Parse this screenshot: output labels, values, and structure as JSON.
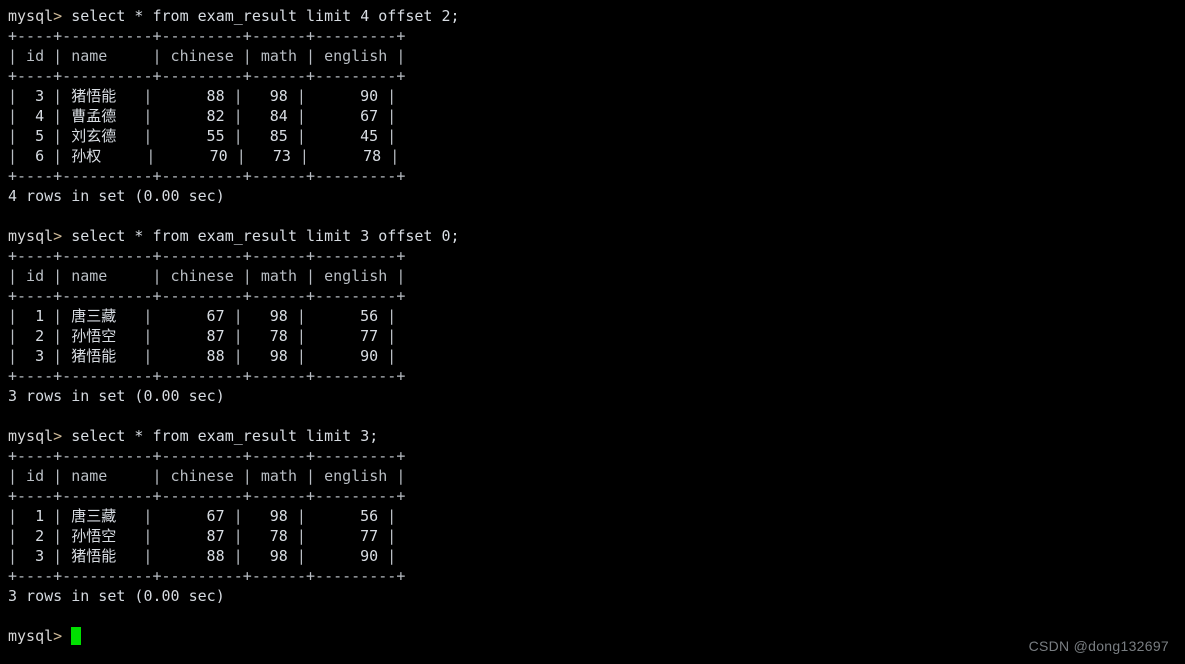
{
  "terminal": {
    "background_color": "#000000",
    "foreground_color": "#cdd2d8",
    "cursor_color": "#00e000",
    "prompt": "mysql>",
    "blocks": [
      {
        "command": " select * from exam_result limit 4 offset 2;",
        "separator": "+----+----------+---------+------+---------+",
        "header": "| id | name     | chinese | math | english |",
        "rows": [
          {
            "id": "3",
            "name": "猪悟能",
            "chinese": "88",
            "math": "98",
            "english": "90"
          },
          {
            "id": "4",
            "name": "曹孟德",
            "chinese": "82",
            "math": "84",
            "english": "67"
          },
          {
            "id": "5",
            "name": "刘玄德",
            "chinese": "55",
            "math": "85",
            "english": "45"
          },
          {
            "id": "6",
            "name": "孙权",
            "chinese": "70",
            "math": "73",
            "english": "78"
          }
        ],
        "status": "4 rows in set (0.00 sec)"
      },
      {
        "command": " select * from exam_result limit 3 offset 0;",
        "separator": "+----+----------+---------+------+---------+",
        "header": "| id | name     | chinese | math | english |",
        "rows": [
          {
            "id": "1",
            "name": "唐三藏",
            "chinese": "67",
            "math": "98",
            "english": "56"
          },
          {
            "id": "2",
            "name": "孙悟空",
            "chinese": "87",
            "math": "78",
            "english": "77"
          },
          {
            "id": "3",
            "name": "猪悟能",
            "chinese": "88",
            "math": "98",
            "english": "90"
          }
        ],
        "status": "3 rows in set (0.00 sec)"
      },
      {
        "command": " select * from exam_result limit 3;",
        "separator": "+----+----------+---------+------+---------+",
        "header": "| id | name     | chinese | math | english |",
        "rows": [
          {
            "id": "1",
            "name": "唐三藏",
            "chinese": "67",
            "math": "98",
            "english": "56"
          },
          {
            "id": "2",
            "name": "孙悟空",
            "chinese": "87",
            "math": "78",
            "english": "77"
          },
          {
            "id": "3",
            "name": "猪悟能",
            "chinese": "88",
            "math": "98",
            "english": "90"
          }
        ],
        "status": "3 rows in set (0.00 sec)"
      }
    ],
    "final_prompt": "mysql>"
  },
  "watermark": {
    "text": "CSDN @dong132697"
  }
}
